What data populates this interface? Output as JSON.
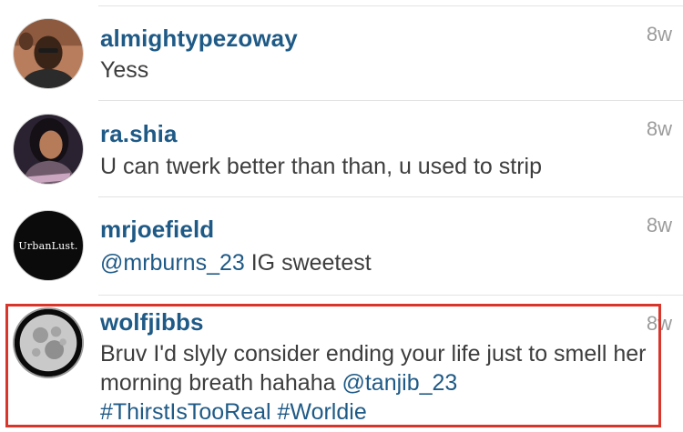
{
  "comments": [
    {
      "username": "almightypezoway",
      "time": "8w",
      "text": "Yess"
    },
    {
      "username": "ra.shia",
      "time": "8w",
      "text": "U can twerk better than than, u used to strip"
    },
    {
      "username": "mrjoefield",
      "time": "8w",
      "avatar_text": "UrbanLust.",
      "mention": "@mrburns_23",
      "text_after": " IG sweetest"
    },
    {
      "username": "wolfjibbs",
      "time": "8w",
      "text_part1": "Bruv I'd slyly consider ending your life just to smell her morning breath hahaha ",
      "mention": "@tanjib_23",
      "hashtag1": "#ThirstIsTooReal",
      "hashtag2": "#Worldie"
    }
  ],
  "colors": {
    "username": "#1f5a86",
    "link": "#1f5a86",
    "body_text": "#3d3d3d",
    "timestamp": "#9b9b9b",
    "highlight": "#d9362b"
  },
  "icons": {
    "comment_1_avatar": "profile-photo-man",
    "comment_2_avatar": "profile-photo-woman",
    "comment_3_avatar": "urbanlust-logo",
    "comment_4_avatar": "full-moon-photo"
  }
}
